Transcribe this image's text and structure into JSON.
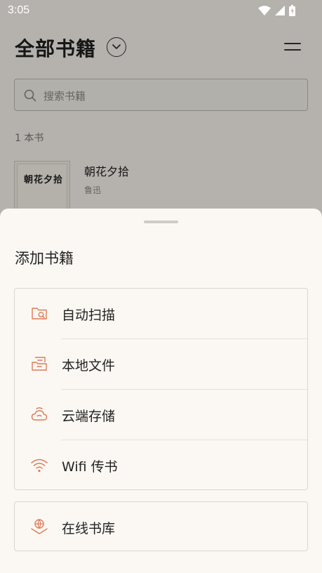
{
  "status_bar": {
    "time": "3:05"
  },
  "library": {
    "title": "全部书籍",
    "search_placeholder": "搜索书籍",
    "book_count": "1 本书",
    "books": [
      {
        "cover_text": "朝花夕拾",
        "title": "朝花夕拾",
        "author": "鲁迅"
      }
    ]
  },
  "sheet": {
    "title": "添加书籍",
    "options": [
      {
        "label": "自动扫描",
        "icon": "folder-search-icon"
      },
      {
        "label": "本地文件",
        "icon": "local-file-icon"
      },
      {
        "label": "云端存储",
        "icon": "cloud-icon"
      },
      {
        "label": "Wifi 传书",
        "icon": "wifi-icon"
      }
    ],
    "online": {
      "label": "在线书库",
      "icon": "online-library-icon"
    }
  },
  "colors": {
    "accent": "#e07a55",
    "sheet_background": "#fbf8f3"
  }
}
